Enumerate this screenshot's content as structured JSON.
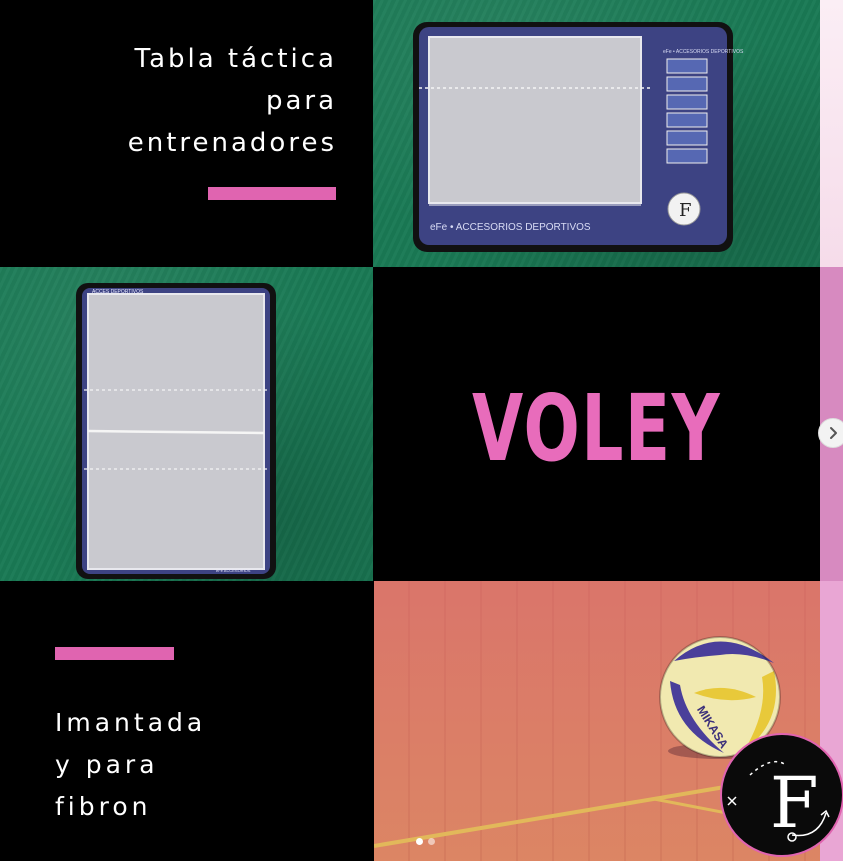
{
  "panels": {
    "title": {
      "lines": [
        "Tabla táctica",
        "para",
        "entrenadores"
      ]
    },
    "horizontal_board": {
      "brand": "eFe • ACCESORIOS DEPORTIVOS",
      "corner_brand": "eFe • ACCESORIOS DEPORTIVOS",
      "logo_letter": "F"
    },
    "vertical_board": {
      "brand_top": "ACCES DEPORTIVOS",
      "brand_bottom": "eFe ACCESORIOS"
    },
    "sport": {
      "label": "VOLEY"
    },
    "features": {
      "lines": [
        "Imantada",
        "y para",
        "fibron"
      ]
    },
    "ball": {
      "brand": "MIKASA"
    }
  },
  "carousel": {
    "next_label": "›",
    "slides": 2,
    "active_index": 0
  },
  "brand_logo": {
    "letter": "F"
  },
  "colors": {
    "accent": "#e064b0",
    "felt": "#1a7a55",
    "board": "#3d4383",
    "background": "#000000"
  }
}
